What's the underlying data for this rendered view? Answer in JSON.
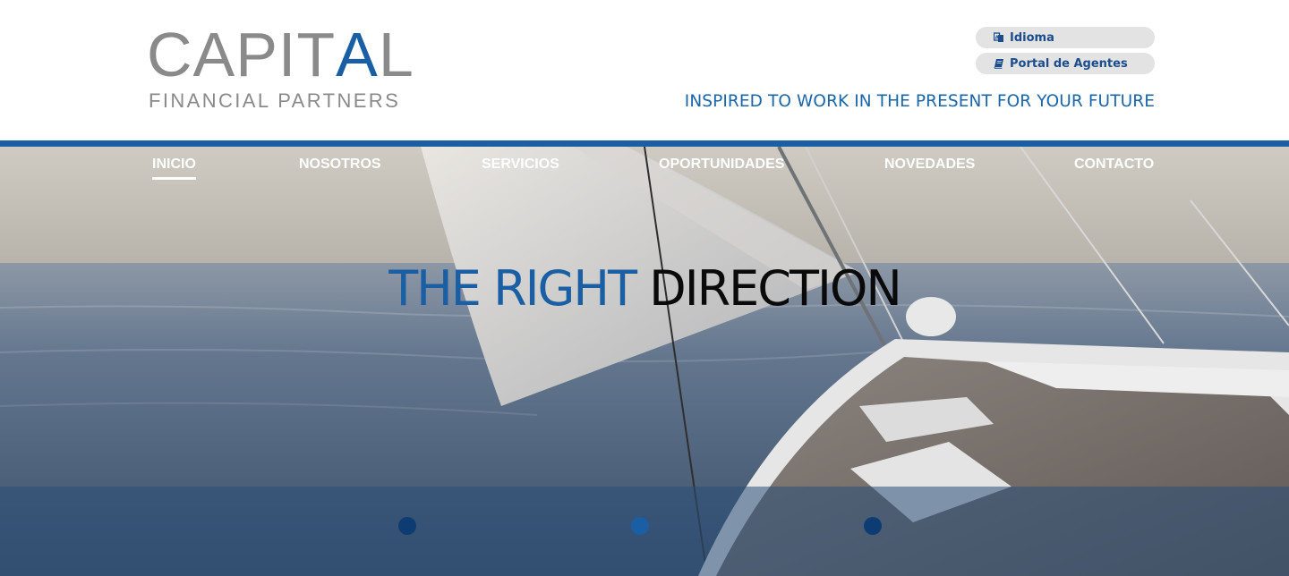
{
  "brand": {
    "logo_main_start": "CAPIT",
    "logo_main_accent": "A",
    "logo_main_end": "L",
    "logo_sub": "FINANCIAL PARTNERS",
    "logo_color": "#8a8a8a",
    "accent_color": "#1a5fa4"
  },
  "top_links": {
    "idioma": {
      "label": "Idioma",
      "icon": "language-icon"
    },
    "portal": {
      "label": "Portal de Agentes",
      "icon": "book-icon"
    }
  },
  "tagline": "INSPIRED TO WORK IN THE PRESENT FOR YOUR FUTURE",
  "nav": {
    "items": [
      {
        "label": "INICIO",
        "active": true
      },
      {
        "label": "NOSOTROS",
        "active": false
      },
      {
        "label": "SERVICIOS",
        "active": false
      },
      {
        "label": "OPORTUNIDADES",
        "active": false
      },
      {
        "label": "NOVEDADES",
        "active": false
      },
      {
        "label": "CONTACTO",
        "active": false
      }
    ]
  },
  "hero": {
    "headline_part1": "THE RIGHT",
    "headline_part2": "DIRECTION",
    "image_alt": "sailboat-on-sea",
    "dots": [
      {
        "color": "#0d3c73",
        "active": false
      },
      {
        "color": "#1a5fa4",
        "active": true
      },
      {
        "color": "#0d3c73",
        "active": false
      }
    ]
  }
}
